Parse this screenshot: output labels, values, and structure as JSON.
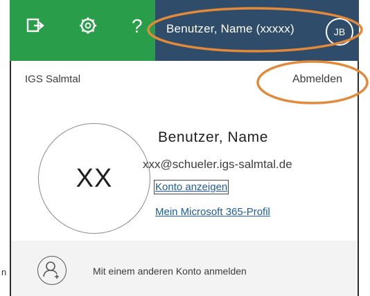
{
  "header": {
    "help_glyph": "?",
    "user_name": "Benutzer, Name (xxxxx)",
    "user_initials": "JB",
    "icons": [
      "compose-send-icon",
      "gear-icon",
      "help-icon"
    ],
    "colors": {
      "left_bar": "#2a9d4a",
      "right_bar": "#2f4d6b"
    }
  },
  "account_panel": {
    "organization": "IGS Salmtal",
    "sign_out": "Abmelden",
    "avatar_initials": "XX",
    "display_name": "Benutzer, Name",
    "email": "xxx@schueler.igs-salmtal.de",
    "view_account": "Konto anzeigen",
    "m365_profile": "Mein Microsoft 365-Profil",
    "other_account": "Mit einem anderen Konto anmelden"
  },
  "edge_fragment": "n",
  "annotation_color": "#e3893a"
}
